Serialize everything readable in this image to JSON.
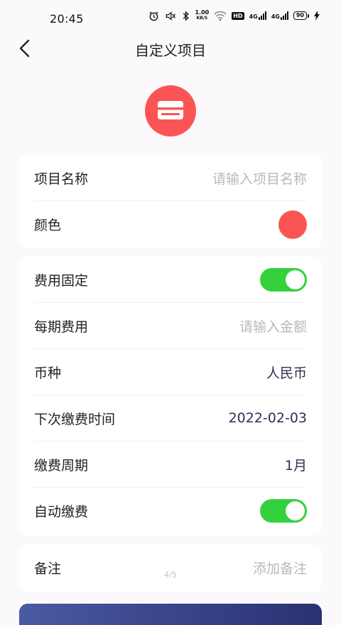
{
  "status_bar": {
    "time": "20:45",
    "net_speed_value": "1.00",
    "net_speed_unit": "KB/S",
    "hd_label": "HD",
    "signal_label_1": "4G",
    "signal_label_2": "4G",
    "battery_level": "90",
    "icons": [
      "alarm-icon",
      "mute-icon",
      "bluetooth-icon",
      "wifi-icon",
      "hd-icon",
      "signal-icon",
      "signal-icon",
      "battery-icon",
      "charging-icon"
    ]
  },
  "header": {
    "title": "自定义项目"
  },
  "project_icon": {
    "icon": "card-icon",
    "color": "#fb5454"
  },
  "basic": {
    "name_label": "项目名称",
    "name_placeholder": "请输入项目名称",
    "color_label": "颜色",
    "color_value": "#fb5454"
  },
  "fee": {
    "fixed_label": "费用固定",
    "fixed_on": true,
    "amount_label": "每期费用",
    "amount_placeholder": "请输入金额",
    "currency_label": "币种",
    "currency_value": "人民币",
    "next_date_label": "下次缴费时间",
    "next_date_value": "2022-02-03",
    "cycle_label": "缴费周期",
    "cycle_value": "1月",
    "auto_pay_label": "自动缴费",
    "auto_pay_on": true
  },
  "note": {
    "label": "备注",
    "placeholder": "添加备注"
  },
  "page_indicator": "4/5",
  "colors": {
    "accent_red": "#fb5454",
    "toggle_green": "#33d23c",
    "button_blue": "#3a4387"
  }
}
